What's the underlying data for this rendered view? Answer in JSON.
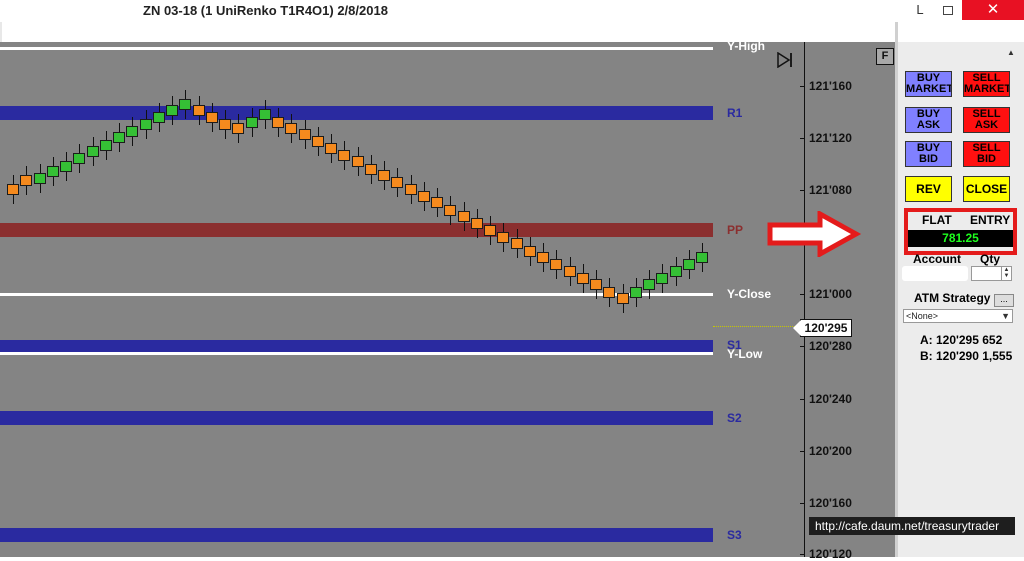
{
  "window": {
    "title": "ZN 03-18 (1 UniRenko T1R4O1)  2/8/2018",
    "minimize_glyph": "L",
    "close_glyph": "✕"
  },
  "chart": {
    "chart_button": "F",
    "top_label": "Y-High",
    "levels": [
      {
        "name": "R1",
        "kind": "band",
        "color": "#2a2aa0"
      },
      {
        "name": "PP",
        "kind": "band",
        "color": "#8b2f2f"
      },
      {
        "name": "Y-Close",
        "kind": "line",
        "color": "#ffffff"
      },
      {
        "name": "S1",
        "kind": "band",
        "color": "#2a2aa0"
      },
      {
        "name": "Y-Low",
        "kind": "line",
        "color": "#ffffff"
      },
      {
        "name": "S2",
        "kind": "band",
        "color": "#2a2aa0"
      },
      {
        "name": "S3",
        "kind": "band",
        "color": "#2a2aa0"
      }
    ],
    "price_labels": [
      "121'160",
      "121'120",
      "121'080",
      "121'000",
      "120'280",
      "120'240",
      "120'200",
      "120'160",
      "120'120"
    ],
    "current_price": "120'295",
    "bars": [
      {
        "d": "down",
        "o": 0.34,
        "c": 0.46
      },
      {
        "d": "down",
        "o": 0.4,
        "c": 0.54
      },
      {
        "d": "up",
        "o": 0.56,
        "c": 0.42
      },
      {
        "d": "up",
        "o": 0.63,
        "c": 0.5
      },
      {
        "d": "up",
        "o": 0.68,
        "c": 0.55
      },
      {
        "d": "up",
        "o": 0.75,
        "c": 0.62
      },
      {
        "d": "up",
        "o": 0.82,
        "c": 0.69
      },
      {
        "d": "up",
        "o": 0.88,
        "c": 0.75
      },
      {
        "d": "up",
        "o": 0.95,
        "c": 0.82
      },
      {
        "d": "up",
        "o": 1.01,
        "c": 0.88
      },
      {
        "d": "up",
        "o": 1.08,
        "c": 0.95
      },
      {
        "d": "up",
        "o": 1.14,
        "c": 1.01
      },
      {
        "d": "up",
        "o": 1.21,
        "c": 1.08
      },
      {
        "d": "up",
        "o": 1.27,
        "c": 1.14
      },
      {
        "d": "down",
        "o": 1.21,
        "c": 1.08
      },
      {
        "d": "down",
        "o": 1.14,
        "c": 1.01
      },
      {
        "d": "down",
        "o": 1.08,
        "c": 0.95
      },
      {
        "d": "down",
        "o": 1.04,
        "c": 0.91
      },
      {
        "d": "up",
        "o": 1.1,
        "c": 0.97
      },
      {
        "d": "up",
        "o": 1.17,
        "c": 1.04
      },
      {
        "d": "down",
        "o": 1.1,
        "c": 0.97
      },
      {
        "d": "down",
        "o": 1.04,
        "c": 0.91
      },
      {
        "d": "down",
        "o": 0.98,
        "c": 0.85
      },
      {
        "d": "down",
        "o": 0.91,
        "c": 0.78
      },
      {
        "d": "down",
        "o": 0.85,
        "c": 0.72
      },
      {
        "d": "down",
        "o": 0.78,
        "c": 0.65
      },
      {
        "d": "down",
        "o": 0.72,
        "c": 0.59
      },
      {
        "d": "down",
        "o": 0.65,
        "c": 0.52
      },
      {
        "d": "down",
        "o": 0.59,
        "c": 0.46
      },
      {
        "d": "down",
        "o": 0.52,
        "c": 0.39
      },
      {
        "d": "down",
        "o": 0.46,
        "c": 0.33
      },
      {
        "d": "down",
        "o": 0.39,
        "c": 0.26
      },
      {
        "d": "down",
        "o": 0.33,
        "c": 0.2
      },
      {
        "d": "down",
        "o": 0.26,
        "c": 0.13
      },
      {
        "d": "down",
        "o": 0.2,
        "c": 0.07
      },
      {
        "d": "down",
        "o": 0.13,
        "c": 0.0
      },
      {
        "d": "down",
        "o": 0.07,
        "c": -0.06
      },
      {
        "d": "down",
        "o": 0.0,
        "c": -0.13
      },
      {
        "d": "down",
        "o": -0.06,
        "c": -0.19
      },
      {
        "d": "down",
        "o": -0.13,
        "c": -0.26
      },
      {
        "d": "down",
        "o": -0.19,
        "c": -0.32
      },
      {
        "d": "down",
        "o": -0.26,
        "c": -0.39
      },
      {
        "d": "down",
        "o": -0.32,
        "c": -0.45
      },
      {
        "d": "down",
        "o": -0.39,
        "c": -0.52
      },
      {
        "d": "down",
        "o": -0.45,
        "c": -0.58
      },
      {
        "d": "down",
        "o": -0.52,
        "c": -0.65
      },
      {
        "d": "down",
        "o": -0.58,
        "c": -0.71
      },
      {
        "d": "up",
        "o": -0.65,
        "c": -0.52
      },
      {
        "d": "up",
        "o": -0.58,
        "c": -0.45
      },
      {
        "d": "up",
        "o": -0.52,
        "c": -0.39
      },
      {
        "d": "up",
        "o": -0.45,
        "c": -0.32
      },
      {
        "d": "up",
        "o": -0.39,
        "c": -0.26
      },
      {
        "d": "up",
        "o": -0.32,
        "c": -0.19
      }
    ]
  },
  "panel": {
    "buttons": [
      {
        "label": "BUY MARKET",
        "style": "blue"
      },
      {
        "label": "SELL MARKET",
        "style": "red"
      },
      {
        "label": "BUY ASK",
        "style": "blue"
      },
      {
        "label": "SELL ASK",
        "style": "red"
      },
      {
        "label": "BUY BID",
        "style": "blue"
      },
      {
        "label": "SELL BID",
        "style": "red"
      },
      {
        "label": "REV",
        "style": "yellow"
      },
      {
        "label": "CLOSE",
        "style": "yellow"
      }
    ],
    "position_label": "FLAT",
    "entry_label": "ENTRY",
    "pnl_value": "781.25",
    "account_label": "Account",
    "qty_label": "Qty",
    "atm_label": "ATM Strategy",
    "atm_dots": "...",
    "atm_value": "<None>",
    "quote_a": "A: 120'295 652",
    "quote_b": "B: 120'290 1,555"
  },
  "watermark": "http://cafe.daum.net/treasurytrader",
  "colors": {
    "bar_up": "#35c035",
    "bar_down": "#f58a1e",
    "highlight_box": "#e41b1b",
    "arrow": "#e41b1b"
  }
}
